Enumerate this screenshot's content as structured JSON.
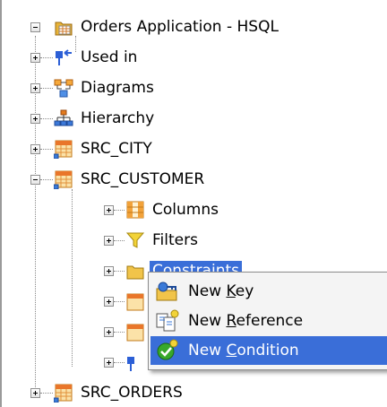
{
  "tree": {
    "root": {
      "label": "Orders Application - HSQL",
      "icon": "data-model-icon"
    },
    "items": [
      {
        "label": "Used in",
        "icon": "arrow-in-icon"
      },
      {
        "label": "Diagrams",
        "icon": "diagram-icon"
      },
      {
        "label": "Hierarchy",
        "icon": "hierarchy-icon"
      },
      {
        "label": "SRC_CITY",
        "icon": "datastore-icon"
      },
      {
        "label": "SRC_CUSTOMER",
        "icon": "datastore-icon"
      },
      {
        "label": "Columns",
        "icon": "columns-icon"
      },
      {
        "label": "Filters",
        "icon": "filter-icon"
      },
      {
        "label": "Constraints",
        "icon": "constraint-folder-icon"
      },
      {
        "label": "SRC_ORDERS",
        "icon": "datastore-icon"
      }
    ]
  },
  "context_menu": {
    "items": [
      {
        "before": "New ",
        "mnemonic": "K",
        "after": "ey",
        "icon": "new-key-icon"
      },
      {
        "before": "New ",
        "mnemonic": "R",
        "after": "eference",
        "icon": "new-reference-icon"
      },
      {
        "before": "New ",
        "mnemonic": "C",
        "after": "ondition",
        "icon": "new-condition-icon"
      }
    ]
  },
  "colors": {
    "selection": "#3a6ed8",
    "menu_background": "#f4f4f4"
  }
}
